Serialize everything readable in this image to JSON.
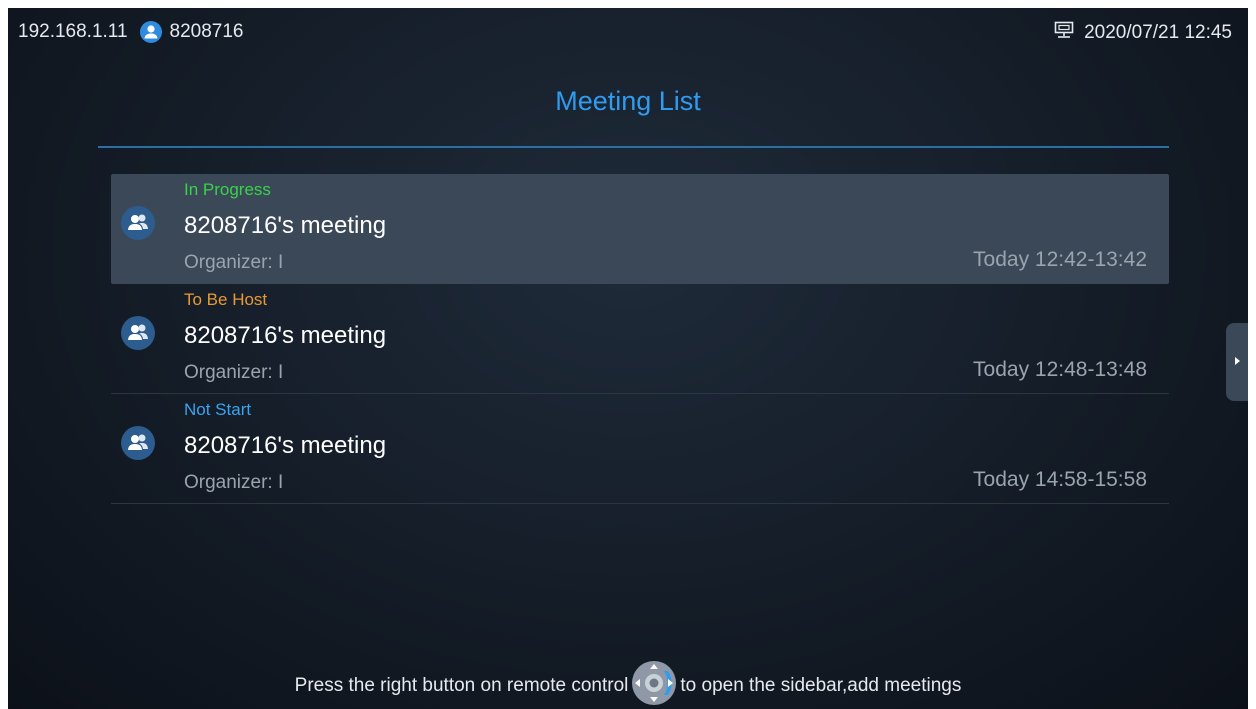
{
  "status_bar": {
    "ip_address": "192.168.1.11",
    "account_icon": "user-icon",
    "account_number": "8208716",
    "network_icon": "lan-icon",
    "datetime": "2020/07/21 12:45"
  },
  "page": {
    "title": "Meeting List"
  },
  "meetings": [
    {
      "status": "In Progress",
      "status_color": "#39d24a",
      "title": "8208716's meeting",
      "organizer": "Organizer: I",
      "time": "Today 12:42-13:42",
      "icon": "group-icon",
      "selected": true
    },
    {
      "status": "To Be Host",
      "status_color": "#e89a34",
      "title": "8208716's meeting",
      "organizer": "Organizer: I",
      "time": "Today 12:48-13:48",
      "icon": "group-icon",
      "selected": false
    },
    {
      "status": "Not Start",
      "status_color": "#3aa4f2",
      "title": "8208716's meeting",
      "organizer": "Organizer: I",
      "time": "Today 14:58-15:58",
      "icon": "group-icon",
      "selected": false
    }
  ],
  "sidebar": {
    "toggle_icon": "chevron-right-icon"
  },
  "hint": {
    "before": "Press the right button on remote control",
    "icon": "remote-dpad-icon",
    "after": "to open the sidebar,add meetings"
  },
  "colors": {
    "accent": "#2f9cf0",
    "background": "#141c27",
    "selected_row": "#3a4857"
  }
}
